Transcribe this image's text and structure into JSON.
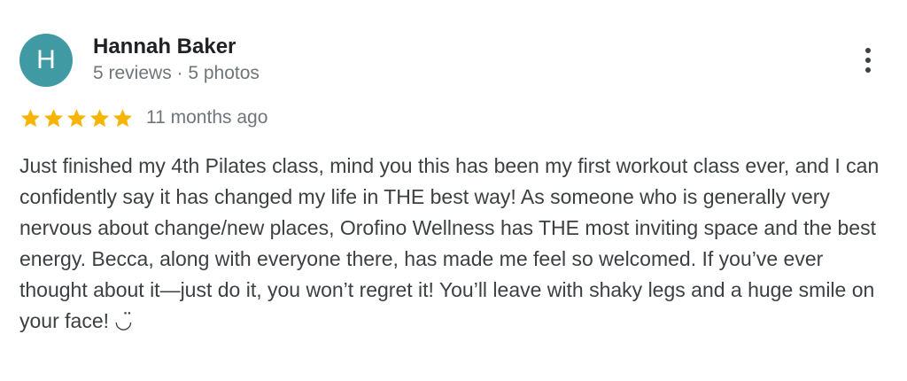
{
  "review": {
    "author": {
      "initial": "H",
      "name": "Hannah Baker",
      "meta": "5 reviews · 5 photos"
    },
    "rating": 5,
    "rating_max": 5,
    "date": "11 months ago",
    "text": "Just finished my 4th Pilates class, mind you this has been my first workout class ever, and I can confidently say it has changed my life in THE best way! As someone who is generally very nervous about change/new places, Orofino Wellness has THE most inviting space and the best energy. Becca, along with everyone there, has made me feel so welcomed. If you’ve ever thought about it—just do it, you won’t regret it! You’ll leave with shaky legs and a huge smile on your face! ◡̈"
  },
  "icons": {
    "star": "star-icon",
    "more": "more-vert-icon"
  },
  "colors": {
    "avatar_bg": "#3f9aa3",
    "star": "#f4b400",
    "name": "#202124",
    "meta": "#70757a",
    "text": "#3c4043"
  }
}
